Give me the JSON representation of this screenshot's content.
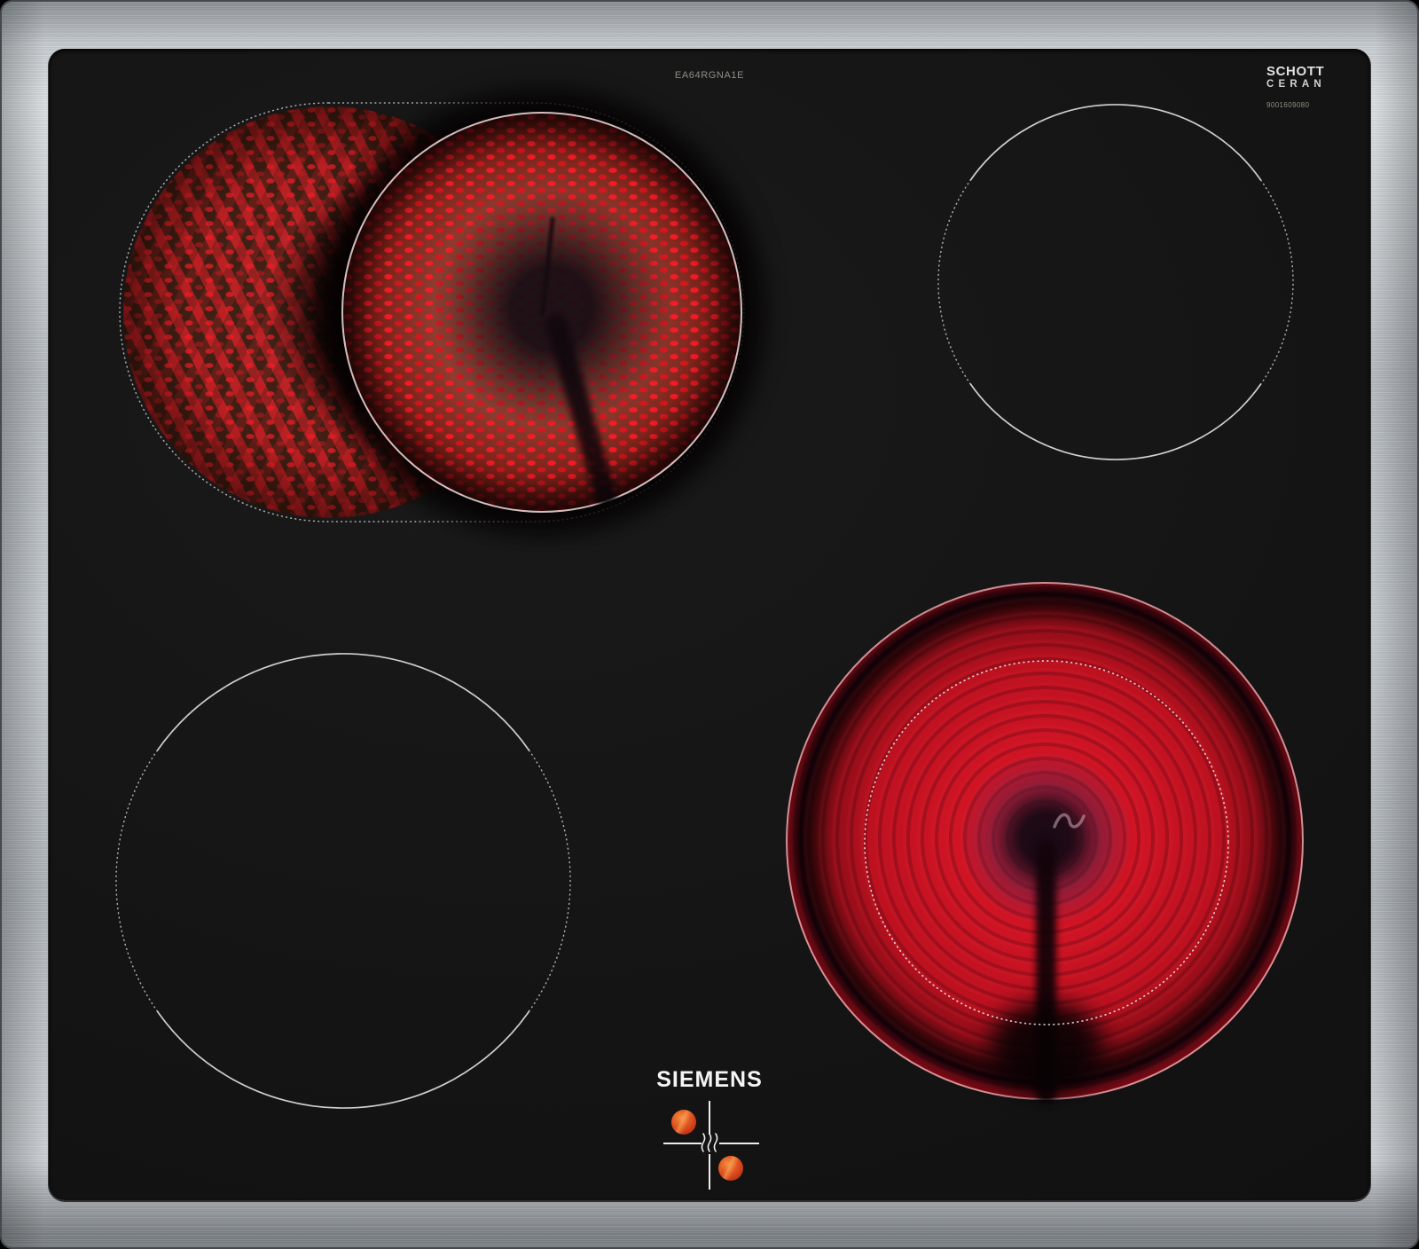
{
  "product": {
    "brand_logo": "SIEMENS",
    "model_label": "EA64RGNA1E",
    "glass_brand": {
      "line1": "SCHOTT",
      "line2": "CERAN",
      "code": "9001609080"
    }
  },
  "zones": [
    {
      "position": "back-left",
      "type": "extended-oval-zone",
      "state": "on",
      "appearance": "main circle glowing bright red, oval extension glowing dim red with dark sensor stem"
    },
    {
      "position": "back-right",
      "type": "single-circuit-zone",
      "state": "off",
      "appearance": "thin outline, solid arcs top and bottom, dotted sides"
    },
    {
      "position": "front-left",
      "type": "single-circuit-zone",
      "state": "off",
      "appearance": "thin outline, solid arcs top and bottom, dotted sides"
    },
    {
      "position": "front-right",
      "type": "dual-circuit-zone",
      "state": "on",
      "appearance": "inner and outer circuits glowing red, dotted inner boundary, dark sensor stem"
    }
  ],
  "residual_heat_indicator": {
    "icon": "steam-waves",
    "hot_zone_dots": 2
  },
  "colors": {
    "glass": "#131313",
    "steel_frame": "#c6cbd0",
    "glow_red_bright": "#ee1629",
    "glow_red_dim": "#7a241c",
    "hot_dot_orange": "#d8481c",
    "outline_white": "#e8e8e8",
    "label_gray": "#8f8d84"
  }
}
